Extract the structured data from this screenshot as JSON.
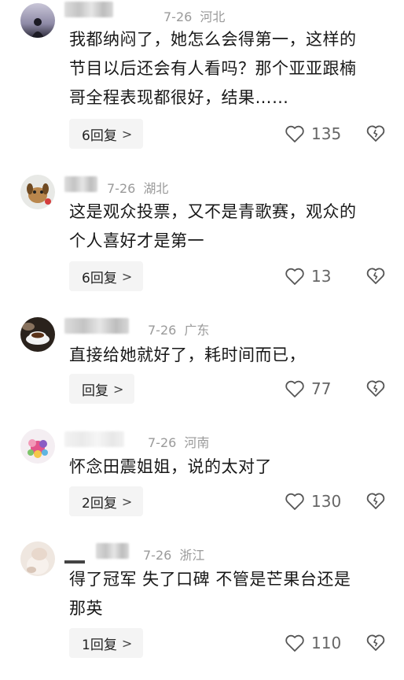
{
  "comments": [
    {
      "date": "7-26",
      "location": "河北",
      "lines": [
        "我都纳闷了，她怎么会得第一，这样的",
        "节目以后还会有人看吗？那个亚亚跟楠",
        "哥全程表现都很好，结果……"
      ],
      "reply_label": "6回复",
      "likes": "135"
    },
    {
      "date": "7-26",
      "location": "湖北",
      "lines": [
        "这是观众投票，又不是青歌赛，观众的",
        "个人喜好才是第一"
      ],
      "reply_label": "6回复",
      "likes": "13"
    },
    {
      "date": "7-26",
      "location": "广东",
      "lines": [
        "直接给她就好了，耗时间而已，"
      ],
      "reply_label": "回复",
      "likes": "77"
    },
    {
      "date": "7-26",
      "location": "河南",
      "lines": [
        "怀念田震姐姐，说的太对了"
      ],
      "reply_label": "2回复",
      "likes": "130"
    },
    {
      "date": "7-26",
      "location": "浙江",
      "lines": [
        "得了冠军 失了口碑 不管是芒果台还是",
        "那英"
      ],
      "reply_label": "1回复",
      "likes": "110"
    }
  ],
  "icons": {
    "reply_chevron": "chevron-right-icon",
    "like": "heart-outline-icon",
    "dislike": "broken-heart-icon"
  },
  "colors": {
    "meta_text": "#9a9a9a",
    "reply_bg": "#f4f4f4",
    "icon_gray": "#555555"
  }
}
